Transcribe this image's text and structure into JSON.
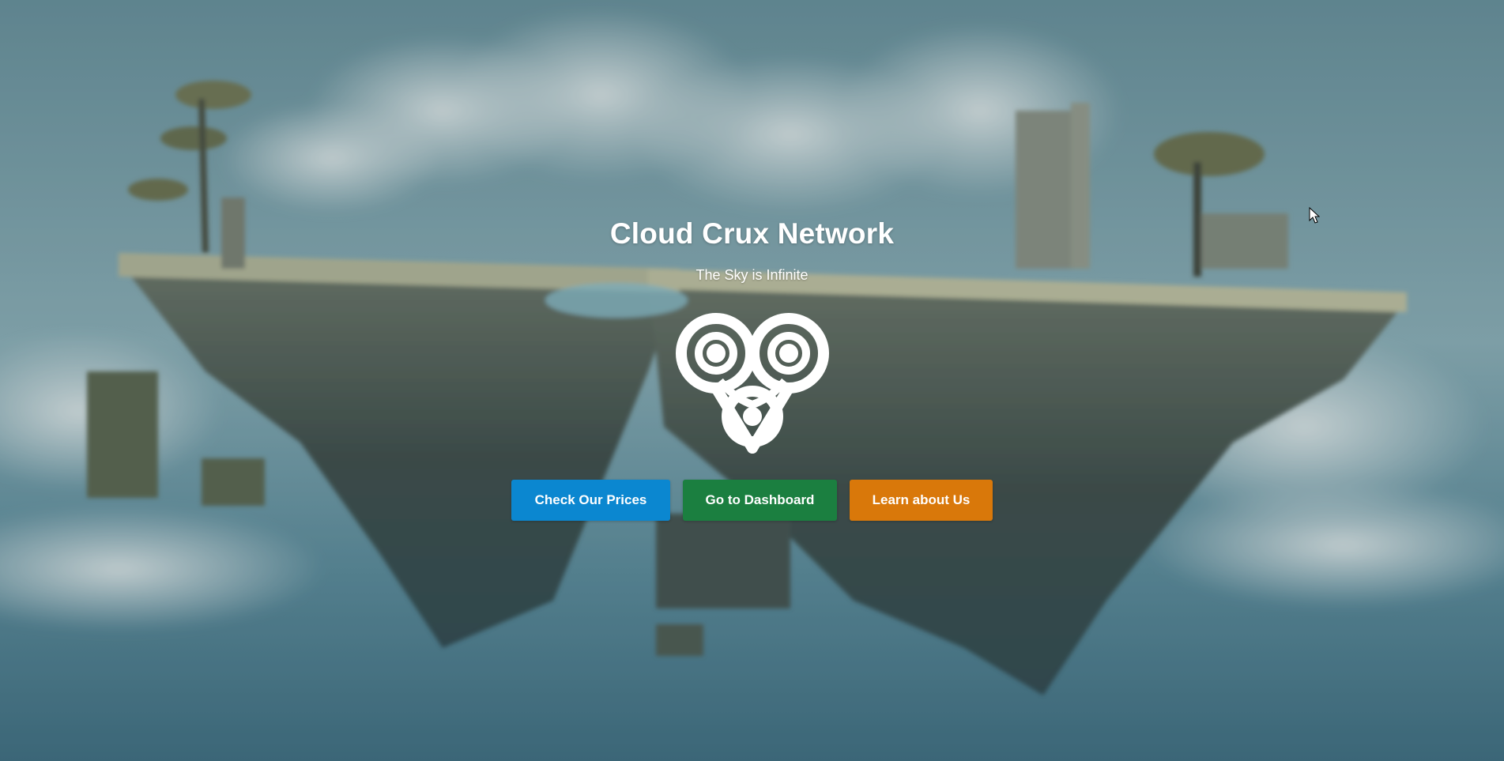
{
  "hero": {
    "title": "Cloud Crux Network",
    "subtitle": "The Sky is Infinite",
    "logo_icon": "cloud-crux-logo-icon"
  },
  "actions": {
    "prices_label": "Check Our Prices",
    "dashboard_label": "Go to Dashboard",
    "about_label": "Learn about Us"
  },
  "colors": {
    "prices": "#0b87d0",
    "dashboard": "#1b7f40",
    "about": "#d9780a",
    "sky": "#5f8796"
  },
  "background_icon": "floating-islands-background-image",
  "cursor_icon": "mouse-pointer-icon"
}
